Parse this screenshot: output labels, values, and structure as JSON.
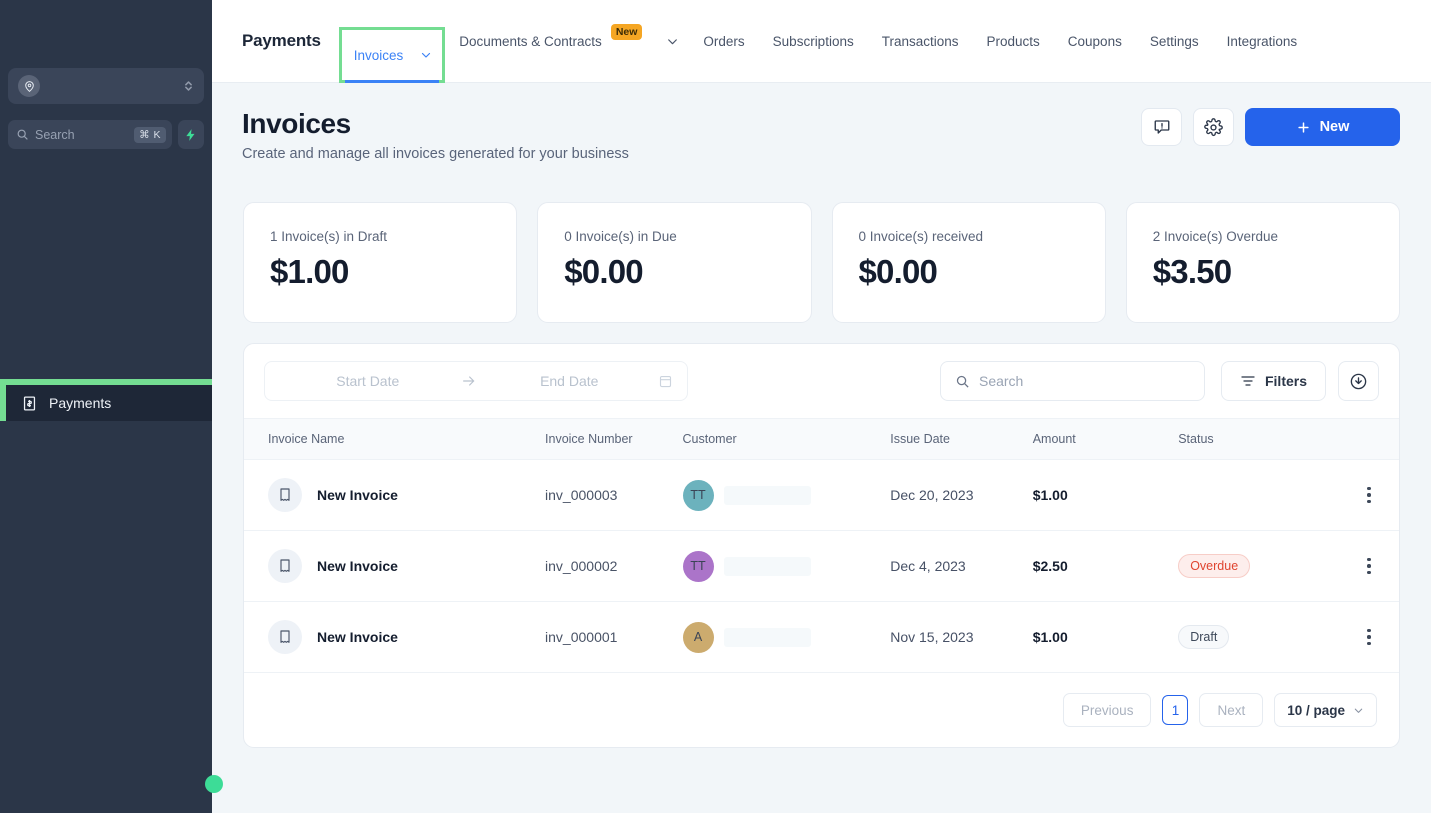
{
  "sidebar": {
    "workspace_switcher": {
      "icon": "user-pin-icon",
      "value": ""
    },
    "search": {
      "placeholder": "Search",
      "shortcut": "⌘ K",
      "icon": "search-icon",
      "spark_icon": "lightning-bolt-icon"
    },
    "items": [
      {
        "label": "Payments",
        "icon": "money-bill-icon",
        "active": true
      }
    ],
    "accent_highlight": "#74dd92",
    "background": "#2b3648"
  },
  "navbar": {
    "brand": "Payments",
    "items": [
      {
        "label": "Invoices",
        "active": true,
        "has_chevron": true
      },
      {
        "label": "Documents & Contracts",
        "badge": "New",
        "has_chevron": true
      },
      {
        "label": "Orders"
      },
      {
        "label": "Subscriptions"
      },
      {
        "label": "Transactions"
      },
      {
        "label": "Products"
      },
      {
        "label": "Coupons"
      },
      {
        "label": "Settings"
      },
      {
        "label": "Integrations"
      }
    ],
    "active_color": "#3b82f6",
    "badge_color": "#f5a623"
  },
  "page": {
    "title": "Invoices",
    "subtitle": "Create and manage all invoices generated for your business",
    "actions": {
      "feedback_icon": "message-alert-icon",
      "settings_icon": "gear-icon",
      "new_label": "New",
      "new_icon": "plus-icon",
      "new_color": "#2563eb"
    }
  },
  "stats": [
    {
      "label": "1 Invoice(s) in Draft",
      "value": "$1.00"
    },
    {
      "label": "0 Invoice(s) in Due",
      "value": "$0.00"
    },
    {
      "label": "0 Invoice(s) received",
      "value": "$0.00"
    },
    {
      "label": "2 Invoice(s) Overdue",
      "value": "$3.50"
    }
  ],
  "toolbar": {
    "start_date_placeholder": "Start Date",
    "end_date_placeholder": "End Date",
    "range_arrow_icon": "arrow-right-icon",
    "calendar_icon": "calendar-icon",
    "search_placeholder": "Search",
    "search_icon": "search-icon",
    "filters_label": "Filters",
    "filters_icon": "filter-lines-icon",
    "download_icon": "download-circle-icon"
  },
  "table": {
    "columns": [
      "Invoice Name",
      "Invoice Number",
      "Customer",
      "Issue Date",
      "Amount",
      "Status"
    ],
    "rows": [
      {
        "name": "New Invoice",
        "icon": "receipt-icon",
        "number": "inv_000003",
        "customer": {
          "initials": "TT",
          "color": "#6cb2bd",
          "name_redacted": true
        },
        "issue_date": "Dec 20, 2023",
        "amount": "$1.00",
        "status": {
          "label": "",
          "type": "redacted"
        },
        "menu_icon": "kebab-menu-icon"
      },
      {
        "name": "New Invoice",
        "icon": "receipt-icon",
        "number": "inv_000002",
        "customer": {
          "initials": "TT",
          "color": "#ab74c9",
          "name_redacted": true
        },
        "issue_date": "Dec 4, 2023",
        "amount": "$2.50",
        "status": {
          "label": "Overdue",
          "type": "overdue"
        },
        "menu_icon": "kebab-menu-icon"
      },
      {
        "name": "New Invoice",
        "icon": "receipt-icon",
        "number": "inv_000001",
        "customer": {
          "initials": "A",
          "color": "#ccab6e",
          "name_redacted": true
        },
        "issue_date": "Nov 15, 2023",
        "amount": "$1.00",
        "status": {
          "label": "Draft",
          "type": "draft"
        },
        "menu_icon": "kebab-menu-icon"
      }
    ]
  },
  "pagination": {
    "previous_label": "Previous",
    "current_page": "1",
    "next_label": "Next",
    "page_size_label": "10 / page",
    "chevron_icon": "chevron-down-icon"
  }
}
